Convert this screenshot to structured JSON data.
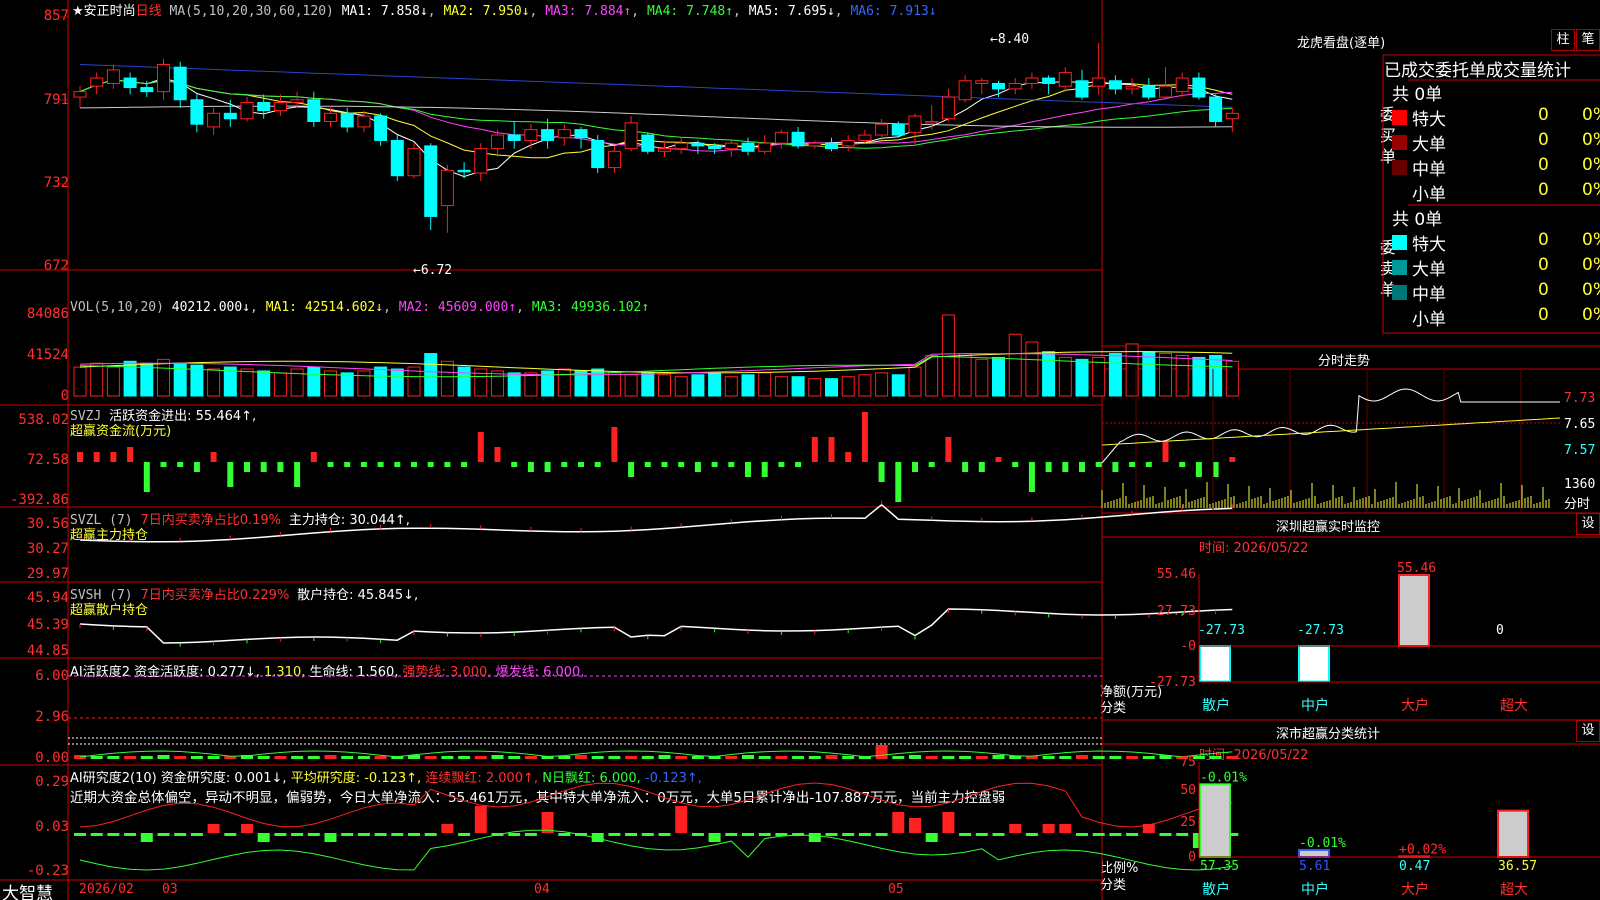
{
  "stock": {
    "name": "★安正时尚",
    "period": "日线"
  },
  "main": {
    "ma_title": "MA(5,10,20,30,60,120)",
    "ma": [
      "MA1: 7.858↓",
      "MA2: 7.950↓",
      "MA3: 7.884↑",
      "MA4: 7.748↑",
      "MA5: 7.695↓",
      "MA6: 7.913↓"
    ],
    "y_ticks": [
      "857",
      "791",
      "732",
      "672"
    ],
    "high_label": "←8.40",
    "low_label": "←6.72",
    "candles": [
      [
        7.98,
        8.02,
        7.9,
        8.06
      ],
      [
        8.06,
        8.12,
        8.0,
        8.16
      ],
      [
        8.08,
        8.18,
        8.04,
        8.22
      ],
      [
        8.12,
        8.05,
        8.0,
        8.16
      ],
      [
        8.05,
        8.02,
        7.98,
        8.1
      ],
      [
        8.02,
        8.22,
        7.96,
        8.26
      ],
      [
        8.2,
        7.96,
        7.9,
        8.24
      ],
      [
        7.96,
        7.78,
        7.72,
        8.0
      ],
      [
        7.76,
        7.86,
        7.7,
        7.9
      ],
      [
        7.86,
        7.82,
        7.76,
        7.96
      ],
      [
        7.82,
        7.94,
        7.8,
        7.98
      ],
      [
        7.94,
        7.88,
        7.82,
        8.0
      ],
      [
        7.88,
        7.94,
        7.84,
        8.0
      ],
      [
        7.94,
        7.96,
        7.9,
        8.02
      ],
      [
        7.96,
        7.8,
        7.76,
        8.02
      ],
      [
        7.8,
        7.86,
        7.76,
        7.9
      ],
      [
        7.86,
        7.76,
        7.72,
        7.9
      ],
      [
        7.76,
        7.84,
        7.72,
        7.88
      ],
      [
        7.84,
        7.66,
        7.62,
        7.86
      ],
      [
        7.66,
        7.4,
        7.36,
        7.7
      ],
      [
        7.4,
        7.6,
        7.38,
        7.64
      ],
      [
        7.62,
        7.1,
        7.0,
        7.64
      ],
      [
        7.18,
        7.44,
        6.98,
        7.48
      ],
      [
        7.44,
        7.43,
        7.38,
        7.5
      ],
      [
        7.42,
        7.6,
        7.36,
        7.64
      ],
      [
        7.6,
        7.7,
        7.54,
        7.74
      ],
      [
        7.7,
        7.66,
        7.6,
        7.8
      ],
      [
        7.66,
        7.74,
        7.6,
        7.78
      ],
      [
        7.74,
        7.66,
        7.6,
        7.82
      ],
      [
        7.68,
        7.74,
        7.62,
        7.78
      ],
      [
        7.74,
        7.68,
        7.6,
        7.76
      ],
      [
        7.66,
        7.46,
        7.42,
        7.7
      ],
      [
        7.46,
        7.58,
        7.42,
        7.62
      ],
      [
        7.6,
        7.79,
        7.58,
        7.84
      ],
      [
        7.7,
        7.58,
        7.56,
        7.72
      ],
      [
        7.58,
        7.6,
        7.54,
        7.66
      ],
      [
        7.6,
        7.64,
        7.56,
        7.68
      ],
      [
        7.64,
        7.62,
        7.56,
        7.66
      ],
      [
        7.62,
        7.6,
        7.56,
        7.64
      ],
      [
        7.6,
        7.64,
        7.54,
        7.66
      ],
      [
        7.64,
        7.58,
        7.55,
        7.68
      ],
      [
        7.58,
        7.64,
        7.56,
        7.7
      ],
      [
        7.64,
        7.72,
        7.6,
        7.74
      ],
      [
        7.72,
        7.62,
        7.6,
        7.76
      ],
      [
        7.62,
        7.64,
        7.6,
        7.66
      ],
      [
        7.64,
        7.6,
        7.58,
        7.68
      ],
      [
        7.62,
        7.66,
        7.58,
        7.7
      ],
      [
        7.66,
        7.7,
        7.64,
        7.74
      ],
      [
        7.7,
        7.78,
        7.66,
        7.82
      ],
      [
        7.78,
        7.7,
        7.68,
        7.8
      ],
      [
        7.72,
        7.84,
        7.62,
        7.86
      ],
      [
        7.8,
        7.8,
        7.74,
        7.92
      ],
      [
        7.82,
        7.98,
        7.8,
        8.04
      ],
      [
        7.96,
        8.1,
        7.94,
        8.14
      ],
      [
        8.08,
        8.1,
        8.0,
        8.12
      ],
      [
        8.08,
        8.04,
        7.98,
        8.1
      ],
      [
        8.04,
        8.08,
        8.0,
        8.12
      ],
      [
        8.08,
        8.12,
        8.04,
        8.16
      ],
      [
        8.12,
        8.08,
        8.0,
        8.14
      ],
      [
        8.06,
        8.16,
        8.02,
        8.2
      ],
      [
        8.1,
        7.98,
        7.96,
        8.18
      ],
      [
        8.06,
        8.12,
        8.0,
        8.38
      ],
      [
        8.1,
        8.04,
        8.0,
        8.14
      ],
      [
        8.04,
        8.06,
        8.0,
        8.12
      ],
      [
        8.06,
        7.98,
        7.96,
        8.12
      ],
      [
        7.98,
        8.06,
        7.96,
        8.2
      ],
      [
        8.02,
        8.12,
        7.98,
        8.16
      ],
      [
        8.12,
        7.98,
        7.96,
        8.16
      ],
      [
        7.98,
        7.8,
        7.76,
        8.0
      ],
      [
        7.82,
        7.86,
        7.72,
        7.9
      ]
    ]
  },
  "vol": {
    "title": "VOL(5,10,20)",
    "value": "40212.000↓",
    "ma": [
      "MA1: 42514.602↓",
      "MA2: 45609.000↑",
      "MA3: 49936.102↑"
    ],
    "y_ticks": [
      "84086",
      "41524",
      "0"
    ]
  },
  "svzj": {
    "title": "SVZJ",
    "t2": "活跃资金进出: 55.464↑,",
    "sub": "超赢资金流(万元)",
    "y_ticks": [
      "538.02",
      "72.58",
      "-392.86"
    ]
  },
  "svzl": {
    "title": "SVZL (7)",
    "t2": "7日内买卖净占比0.19%",
    "t3": "主力持仓: 30.044↑,",
    "sub": "超赢主力持仓",
    "y_ticks": [
      "30.56",
      "30.27",
      "29.97"
    ]
  },
  "svsh": {
    "title": "SVSH (7)",
    "t2": "7日内买卖净占比0.229%",
    "t3": "散户持仓: 45.845↓,",
    "sub": "超赢散户持仓",
    "y_ticks": [
      "45.94",
      "45.39",
      "44.85"
    ]
  },
  "ai1": {
    "t1": "AI活跃度2 资金活跃度: 0.277↓,",
    "t2": "1.310,",
    "t3": "生命线: 1.560,",
    "t4": "强势线: 3.000,",
    "t5": "爆发线: 6.000,",
    "y_ticks": [
      "6.00",
      "2.96",
      "0.00"
    ]
  },
  "ai2": {
    "t1": "AI研究度2(10) 资金研究度: 0.001↓,",
    "t2": "平均研究度: -0.123↑,",
    "t3": "连续飘红: 2.000↑,",
    "t4": "N日飘红: 6.000,",
    "t5": "-0.123↑,",
    "comment": "近期大资金总体偏空，异动不明显，偏弱势，今日大单净流入：55.461万元，其中特大单净流入：0万元，大单5日累计净出-107.887万元，当前主力控盘弱",
    "y_ticks": [
      "0.29",
      "0.03",
      "-0.23"
    ]
  },
  "bottom": {
    "brand": "大智慧",
    "dates": [
      "2026/02",
      "03",
      "04",
      "05"
    ]
  },
  "dragon": {
    "title": "龙虎看盘(逐单)",
    "btn1": "柱",
    "btn2": "笔",
    "header": "已成交委托单成交量统计",
    "buy": {
      "label": "委买单",
      "total": "共 0单",
      "rows": [
        {
          "name": "特大",
          "count": "0",
          "pct": "0%",
          "color": "#ff0000"
        },
        {
          "name": "大单",
          "count": "0",
          "pct": "0%",
          "color": "#990000"
        },
        {
          "name": "中单",
          "count": "0",
          "pct": "0%",
          "color": "#660000"
        },
        {
          "name": "小单",
          "count": "0",
          "pct": "0%",
          "color": "#000000"
        }
      ]
    },
    "sell": {
      "label": "委卖单",
      "total": "共 0单",
      "rows": [
        {
          "name": "特大",
          "count": "0",
          "pct": "0%",
          "color": "#00ffff"
        },
        {
          "name": "大单",
          "count": "0",
          "pct": "0%",
          "color": "#009999"
        },
        {
          "name": "中单",
          "count": "0",
          "pct": "0%",
          "color": "#007777"
        },
        {
          "name": "小单",
          "count": "0",
          "pct": "0%",
          "color": "#000000"
        }
      ]
    }
  },
  "intraday": {
    "title": "分时走势",
    "prices": [
      "7.73",
      "7.65",
      "7.57"
    ],
    "vol": "1360",
    "vol_unit": "分时"
  },
  "monitor": {
    "title": "深圳超赢实时监控",
    "btn": "设",
    "time": "时间: 2026/05/22",
    "y_ticks": [
      "55.46",
      "27.73",
      "-0",
      "-27.73"
    ],
    "ylabel1": "净额(万元)",
    "ylabel2": "分类",
    "bars": [
      {
        "cat": "散户",
        "value": -27.73,
        "label": "-27.73"
      },
      {
        "cat": "中户",
        "value": -27.73,
        "label": "-27.73"
      },
      {
        "cat": "大户",
        "value": 55.46,
        "label": "55.46"
      },
      {
        "cat": "超大",
        "value": 0,
        "label": "0"
      }
    ]
  },
  "classify": {
    "title": "深市超赢分类统计",
    "btn": "设",
    "time": "时间: 2026/05/22",
    "y_ticks": [
      "75",
      "50",
      "25",
      "0"
    ],
    "ylabel1": "比例%",
    "ylabel2": "分类",
    "bars": [
      {
        "cat": "散户",
        "value": 57.35,
        "label": "57.35",
        "chg": "-0.01%"
      },
      {
        "cat": "中户",
        "value": 5.61,
        "label": "5.61",
        "chg": "-0.01%"
      },
      {
        "cat": "大户",
        "value": 0.47,
        "label": "0.47",
        "chg": "+0.02%"
      },
      {
        "cat": "超大",
        "value": 36.57,
        "label": "36.57",
        "chg": ""
      }
    ]
  }
}
